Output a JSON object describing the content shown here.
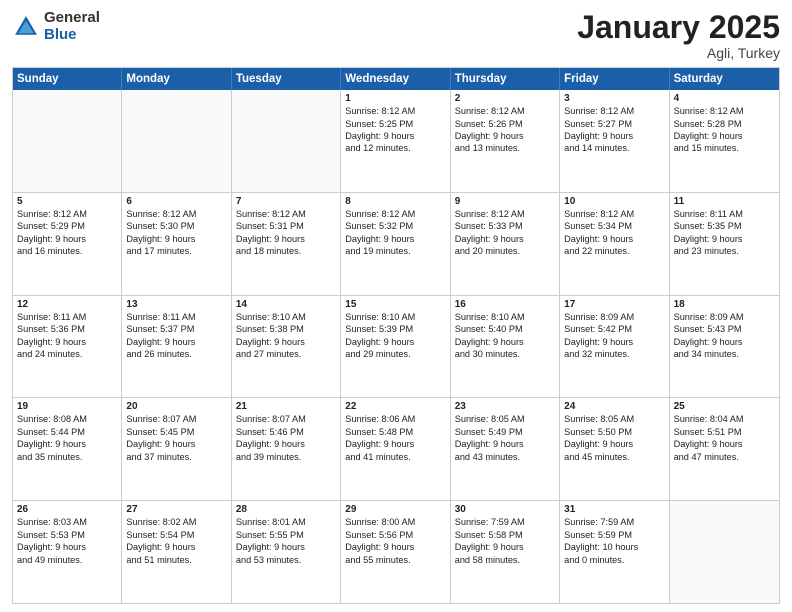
{
  "logo": {
    "general": "General",
    "blue": "Blue"
  },
  "title": "January 2025",
  "location": "Agli, Turkey",
  "header_days": [
    "Sunday",
    "Monday",
    "Tuesday",
    "Wednesday",
    "Thursday",
    "Friday",
    "Saturday"
  ],
  "weeks": [
    [
      {
        "day": "",
        "lines": []
      },
      {
        "day": "",
        "lines": []
      },
      {
        "day": "",
        "lines": []
      },
      {
        "day": "1",
        "lines": [
          "Sunrise: 8:12 AM",
          "Sunset: 5:25 PM",
          "Daylight: 9 hours",
          "and 12 minutes."
        ]
      },
      {
        "day": "2",
        "lines": [
          "Sunrise: 8:12 AM",
          "Sunset: 5:26 PM",
          "Daylight: 9 hours",
          "and 13 minutes."
        ]
      },
      {
        "day": "3",
        "lines": [
          "Sunrise: 8:12 AM",
          "Sunset: 5:27 PM",
          "Daylight: 9 hours",
          "and 14 minutes."
        ]
      },
      {
        "day": "4",
        "lines": [
          "Sunrise: 8:12 AM",
          "Sunset: 5:28 PM",
          "Daylight: 9 hours",
          "and 15 minutes."
        ]
      }
    ],
    [
      {
        "day": "5",
        "lines": [
          "Sunrise: 8:12 AM",
          "Sunset: 5:29 PM",
          "Daylight: 9 hours",
          "and 16 minutes."
        ]
      },
      {
        "day": "6",
        "lines": [
          "Sunrise: 8:12 AM",
          "Sunset: 5:30 PM",
          "Daylight: 9 hours",
          "and 17 minutes."
        ]
      },
      {
        "day": "7",
        "lines": [
          "Sunrise: 8:12 AM",
          "Sunset: 5:31 PM",
          "Daylight: 9 hours",
          "and 18 minutes."
        ]
      },
      {
        "day": "8",
        "lines": [
          "Sunrise: 8:12 AM",
          "Sunset: 5:32 PM",
          "Daylight: 9 hours",
          "and 19 minutes."
        ]
      },
      {
        "day": "9",
        "lines": [
          "Sunrise: 8:12 AM",
          "Sunset: 5:33 PM",
          "Daylight: 9 hours",
          "and 20 minutes."
        ]
      },
      {
        "day": "10",
        "lines": [
          "Sunrise: 8:12 AM",
          "Sunset: 5:34 PM",
          "Daylight: 9 hours",
          "and 22 minutes."
        ]
      },
      {
        "day": "11",
        "lines": [
          "Sunrise: 8:11 AM",
          "Sunset: 5:35 PM",
          "Daylight: 9 hours",
          "and 23 minutes."
        ]
      }
    ],
    [
      {
        "day": "12",
        "lines": [
          "Sunrise: 8:11 AM",
          "Sunset: 5:36 PM",
          "Daylight: 9 hours",
          "and 24 minutes."
        ]
      },
      {
        "day": "13",
        "lines": [
          "Sunrise: 8:11 AM",
          "Sunset: 5:37 PM",
          "Daylight: 9 hours",
          "and 26 minutes."
        ]
      },
      {
        "day": "14",
        "lines": [
          "Sunrise: 8:10 AM",
          "Sunset: 5:38 PM",
          "Daylight: 9 hours",
          "and 27 minutes."
        ]
      },
      {
        "day": "15",
        "lines": [
          "Sunrise: 8:10 AM",
          "Sunset: 5:39 PM",
          "Daylight: 9 hours",
          "and 29 minutes."
        ]
      },
      {
        "day": "16",
        "lines": [
          "Sunrise: 8:10 AM",
          "Sunset: 5:40 PM",
          "Daylight: 9 hours",
          "and 30 minutes."
        ]
      },
      {
        "day": "17",
        "lines": [
          "Sunrise: 8:09 AM",
          "Sunset: 5:42 PM",
          "Daylight: 9 hours",
          "and 32 minutes."
        ]
      },
      {
        "day": "18",
        "lines": [
          "Sunrise: 8:09 AM",
          "Sunset: 5:43 PM",
          "Daylight: 9 hours",
          "and 34 minutes."
        ]
      }
    ],
    [
      {
        "day": "19",
        "lines": [
          "Sunrise: 8:08 AM",
          "Sunset: 5:44 PM",
          "Daylight: 9 hours",
          "and 35 minutes."
        ]
      },
      {
        "day": "20",
        "lines": [
          "Sunrise: 8:07 AM",
          "Sunset: 5:45 PM",
          "Daylight: 9 hours",
          "and 37 minutes."
        ]
      },
      {
        "day": "21",
        "lines": [
          "Sunrise: 8:07 AM",
          "Sunset: 5:46 PM",
          "Daylight: 9 hours",
          "and 39 minutes."
        ]
      },
      {
        "day": "22",
        "lines": [
          "Sunrise: 8:06 AM",
          "Sunset: 5:48 PM",
          "Daylight: 9 hours",
          "and 41 minutes."
        ]
      },
      {
        "day": "23",
        "lines": [
          "Sunrise: 8:05 AM",
          "Sunset: 5:49 PM",
          "Daylight: 9 hours",
          "and 43 minutes."
        ]
      },
      {
        "day": "24",
        "lines": [
          "Sunrise: 8:05 AM",
          "Sunset: 5:50 PM",
          "Daylight: 9 hours",
          "and 45 minutes."
        ]
      },
      {
        "day": "25",
        "lines": [
          "Sunrise: 8:04 AM",
          "Sunset: 5:51 PM",
          "Daylight: 9 hours",
          "and 47 minutes."
        ]
      }
    ],
    [
      {
        "day": "26",
        "lines": [
          "Sunrise: 8:03 AM",
          "Sunset: 5:53 PM",
          "Daylight: 9 hours",
          "and 49 minutes."
        ]
      },
      {
        "day": "27",
        "lines": [
          "Sunrise: 8:02 AM",
          "Sunset: 5:54 PM",
          "Daylight: 9 hours",
          "and 51 minutes."
        ]
      },
      {
        "day": "28",
        "lines": [
          "Sunrise: 8:01 AM",
          "Sunset: 5:55 PM",
          "Daylight: 9 hours",
          "and 53 minutes."
        ]
      },
      {
        "day": "29",
        "lines": [
          "Sunrise: 8:00 AM",
          "Sunset: 5:56 PM",
          "Daylight: 9 hours",
          "and 55 minutes."
        ]
      },
      {
        "day": "30",
        "lines": [
          "Sunrise: 7:59 AM",
          "Sunset: 5:58 PM",
          "Daylight: 9 hours",
          "and 58 minutes."
        ]
      },
      {
        "day": "31",
        "lines": [
          "Sunrise: 7:59 AM",
          "Sunset: 5:59 PM",
          "Daylight: 10 hours",
          "and 0 minutes."
        ]
      },
      {
        "day": "",
        "lines": []
      }
    ]
  ]
}
